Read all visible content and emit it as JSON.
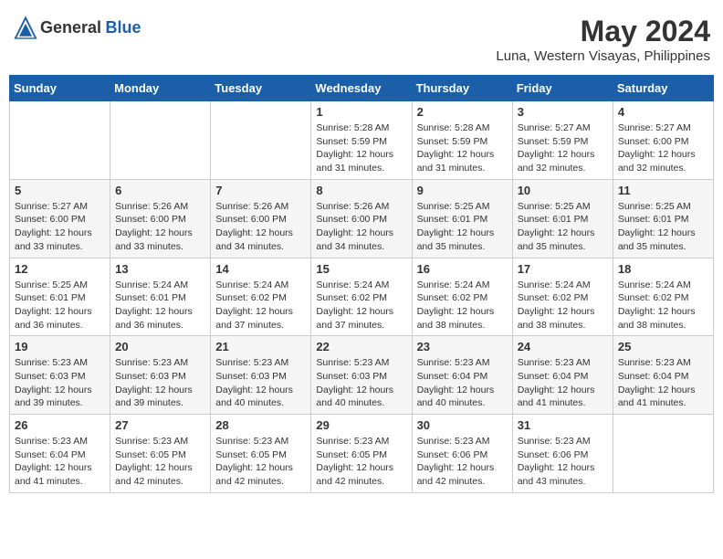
{
  "header": {
    "logo": {
      "general": "General",
      "blue": "Blue"
    },
    "title": "May 2024",
    "location": "Luna, Western Visayas, Philippines"
  },
  "calendar": {
    "days_of_week": [
      "Sunday",
      "Monday",
      "Tuesday",
      "Wednesday",
      "Thursday",
      "Friday",
      "Saturday"
    ],
    "weeks": [
      [
        {
          "day": "",
          "info": ""
        },
        {
          "day": "",
          "info": ""
        },
        {
          "day": "",
          "info": ""
        },
        {
          "day": "1",
          "sunrise": "Sunrise: 5:28 AM",
          "sunset": "Sunset: 5:59 PM",
          "daylight": "Daylight: 12 hours and 31 minutes."
        },
        {
          "day": "2",
          "sunrise": "Sunrise: 5:28 AM",
          "sunset": "Sunset: 5:59 PM",
          "daylight": "Daylight: 12 hours and 31 minutes."
        },
        {
          "day": "3",
          "sunrise": "Sunrise: 5:27 AM",
          "sunset": "Sunset: 5:59 PM",
          "daylight": "Daylight: 12 hours and 32 minutes."
        },
        {
          "day": "4",
          "sunrise": "Sunrise: 5:27 AM",
          "sunset": "Sunset: 6:00 PM",
          "daylight": "Daylight: 12 hours and 32 minutes."
        }
      ],
      [
        {
          "day": "5",
          "sunrise": "Sunrise: 5:27 AM",
          "sunset": "Sunset: 6:00 PM",
          "daylight": "Daylight: 12 hours and 33 minutes."
        },
        {
          "day": "6",
          "sunrise": "Sunrise: 5:26 AM",
          "sunset": "Sunset: 6:00 PM",
          "daylight": "Daylight: 12 hours and 33 minutes."
        },
        {
          "day": "7",
          "sunrise": "Sunrise: 5:26 AM",
          "sunset": "Sunset: 6:00 PM",
          "daylight": "Daylight: 12 hours and 34 minutes."
        },
        {
          "day": "8",
          "sunrise": "Sunrise: 5:26 AM",
          "sunset": "Sunset: 6:00 PM",
          "daylight": "Daylight: 12 hours and 34 minutes."
        },
        {
          "day": "9",
          "sunrise": "Sunrise: 5:25 AM",
          "sunset": "Sunset: 6:01 PM",
          "daylight": "Daylight: 12 hours and 35 minutes."
        },
        {
          "day": "10",
          "sunrise": "Sunrise: 5:25 AM",
          "sunset": "Sunset: 6:01 PM",
          "daylight": "Daylight: 12 hours and 35 minutes."
        },
        {
          "day": "11",
          "sunrise": "Sunrise: 5:25 AM",
          "sunset": "Sunset: 6:01 PM",
          "daylight": "Daylight: 12 hours and 35 minutes."
        }
      ],
      [
        {
          "day": "12",
          "sunrise": "Sunrise: 5:25 AM",
          "sunset": "Sunset: 6:01 PM",
          "daylight": "Daylight: 12 hours and 36 minutes."
        },
        {
          "day": "13",
          "sunrise": "Sunrise: 5:24 AM",
          "sunset": "Sunset: 6:01 PM",
          "daylight": "Daylight: 12 hours and 36 minutes."
        },
        {
          "day": "14",
          "sunrise": "Sunrise: 5:24 AM",
          "sunset": "Sunset: 6:02 PM",
          "daylight": "Daylight: 12 hours and 37 minutes."
        },
        {
          "day": "15",
          "sunrise": "Sunrise: 5:24 AM",
          "sunset": "Sunset: 6:02 PM",
          "daylight": "Daylight: 12 hours and 37 minutes."
        },
        {
          "day": "16",
          "sunrise": "Sunrise: 5:24 AM",
          "sunset": "Sunset: 6:02 PM",
          "daylight": "Daylight: 12 hours and 38 minutes."
        },
        {
          "day": "17",
          "sunrise": "Sunrise: 5:24 AM",
          "sunset": "Sunset: 6:02 PM",
          "daylight": "Daylight: 12 hours and 38 minutes."
        },
        {
          "day": "18",
          "sunrise": "Sunrise: 5:24 AM",
          "sunset": "Sunset: 6:02 PM",
          "daylight": "Daylight: 12 hours and 38 minutes."
        }
      ],
      [
        {
          "day": "19",
          "sunrise": "Sunrise: 5:23 AM",
          "sunset": "Sunset: 6:03 PM",
          "daylight": "Daylight: 12 hours and 39 minutes."
        },
        {
          "day": "20",
          "sunrise": "Sunrise: 5:23 AM",
          "sunset": "Sunset: 6:03 PM",
          "daylight": "Daylight: 12 hours and 39 minutes."
        },
        {
          "day": "21",
          "sunrise": "Sunrise: 5:23 AM",
          "sunset": "Sunset: 6:03 PM",
          "daylight": "Daylight: 12 hours and 40 minutes."
        },
        {
          "day": "22",
          "sunrise": "Sunrise: 5:23 AM",
          "sunset": "Sunset: 6:03 PM",
          "daylight": "Daylight: 12 hours and 40 minutes."
        },
        {
          "day": "23",
          "sunrise": "Sunrise: 5:23 AM",
          "sunset": "Sunset: 6:04 PM",
          "daylight": "Daylight: 12 hours and 40 minutes."
        },
        {
          "day": "24",
          "sunrise": "Sunrise: 5:23 AM",
          "sunset": "Sunset: 6:04 PM",
          "daylight": "Daylight: 12 hours and 41 minutes."
        },
        {
          "day": "25",
          "sunrise": "Sunrise: 5:23 AM",
          "sunset": "Sunset: 6:04 PM",
          "daylight": "Daylight: 12 hours and 41 minutes."
        }
      ],
      [
        {
          "day": "26",
          "sunrise": "Sunrise: 5:23 AM",
          "sunset": "Sunset: 6:04 PM",
          "daylight": "Daylight: 12 hours and 41 minutes."
        },
        {
          "day": "27",
          "sunrise": "Sunrise: 5:23 AM",
          "sunset": "Sunset: 6:05 PM",
          "daylight": "Daylight: 12 hours and 42 minutes."
        },
        {
          "day": "28",
          "sunrise": "Sunrise: 5:23 AM",
          "sunset": "Sunset: 6:05 PM",
          "daylight": "Daylight: 12 hours and 42 minutes."
        },
        {
          "day": "29",
          "sunrise": "Sunrise: 5:23 AM",
          "sunset": "Sunset: 6:05 PM",
          "daylight": "Daylight: 12 hours and 42 minutes."
        },
        {
          "day": "30",
          "sunrise": "Sunrise: 5:23 AM",
          "sunset": "Sunset: 6:06 PM",
          "daylight": "Daylight: 12 hours and 42 minutes."
        },
        {
          "day": "31",
          "sunrise": "Sunrise: 5:23 AM",
          "sunset": "Sunset: 6:06 PM",
          "daylight": "Daylight: 12 hours and 43 minutes."
        },
        {
          "day": "",
          "info": ""
        }
      ]
    ]
  }
}
